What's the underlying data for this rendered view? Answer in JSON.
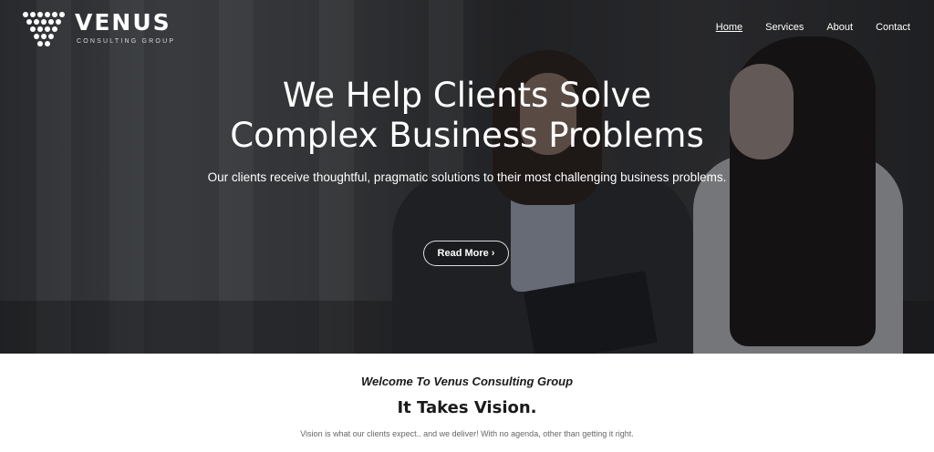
{
  "brand": {
    "name": "VENUS",
    "subtitle": "CONSULTING GROUP"
  },
  "nav": {
    "items": [
      {
        "label": "Home",
        "active": true
      },
      {
        "label": "Services",
        "active": false
      },
      {
        "label": "About",
        "active": false
      },
      {
        "label": "Contact",
        "active": false
      }
    ]
  },
  "hero": {
    "headline_line1": "We Help Clients Solve",
    "headline_line2": "Complex Business Problems",
    "subheadline": "Our clients receive thoughtful, pragmatic solutions to their most challenging business problems.",
    "cta_label": "Read More ›"
  },
  "intro": {
    "welcome": "Welcome To Venus Consulting Group",
    "tagline": "It Takes Vision.",
    "body": "Vision is what our clients expect.. and we deliver! With no agenda, other than getting it right."
  }
}
